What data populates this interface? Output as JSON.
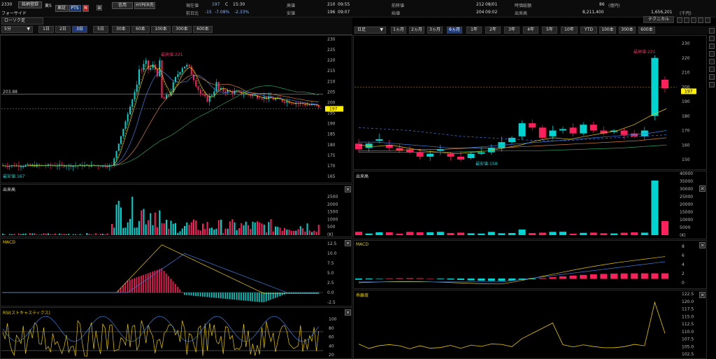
{
  "header": {
    "code": "2330",
    "register_btn": "銘柄登録",
    "market": "東S",
    "company": "フォーサイド",
    "market_tabs": [
      "東証",
      "PTS"
    ],
    "n_badge": "N",
    "margin_btn": "信用",
    "hyper_btn": "HYPER売",
    "stats": {
      "current_label": "現在値",
      "current_value": "197",
      "current_flag": "C",
      "current_time": "15:30",
      "change_label": "前日比",
      "change_value": "-15",
      "change_pct": "-7.08%",
      "change_pct2": "-2.33%",
      "high_label": "高値",
      "high_value": "210",
      "high_time": "09:55",
      "low_label": "安値",
      "low_value": "196",
      "low_time": "09:07",
      "prev_close_label": "前終値",
      "prev_close_value": "212",
      "prev_close_date": "08/01",
      "open_label": "始値",
      "open_value": "204",
      "open_time": "09:02",
      "market_cap_label": "時価総額",
      "market_cap_value": "86",
      "market_cap_unit": "(億円)",
      "volume_label": "出来高",
      "volume_value": "8,211,400",
      "turnover_value": "1,656,201",
      "turnover_unit": "(千円)"
    }
  },
  "left": {
    "chart_type": "ローソク足",
    "interval": "5分",
    "tabs": [
      "1日",
      "2日",
      "3日",
      "5日",
      "30本",
      "60本",
      "100本",
      "300本",
      "600本"
    ],
    "selected_tab": "3日",
    "price_axis": [
      "230",
      "225",
      "220",
      "215",
      "210",
      "205",
      "200",
      "195",
      "190",
      "185",
      "180",
      "175",
      "170",
      "165"
    ],
    "line_label": "203.88",
    "current_price_tag": "197",
    "high_note": "最高値:221",
    "low_note": "最安値:167",
    "volume_label": "出来高",
    "volume_axis": [
      "2500",
      "2000",
      "1500",
      "1000",
      "500",
      "(K)"
    ],
    "macd_label": "MACD",
    "macd_axis": [
      "12.5",
      "10.0",
      "7.5",
      "5.0",
      "2.5",
      "0.0",
      "-2.5"
    ],
    "rsi_label": "RSI(ストキャスティクス)",
    "rsi_axis": [
      "100",
      "80",
      "60",
      "40",
      "20"
    ]
  },
  "right": {
    "interval": "日足",
    "tabs": [
      "1ヵ月",
      "2ヵ月",
      "3ヵ月",
      "6ヵ月",
      "1年",
      "2年",
      "3年",
      "4年",
      "5年",
      "10年",
      "YTD",
      "100本",
      "300本",
      "600本"
    ],
    "selected_tab": "6ヵ月",
    "tech_btn": "テクニカル",
    "price_axis": [
      "230",
      "220",
      "210",
      "200",
      "190",
      "180",
      "170",
      "160",
      "150"
    ],
    "current_price_tag": "197",
    "high_note": "最高値:221",
    "low_note": "最安値:150",
    "volume_label": "出来高",
    "volume_axis": [
      "40000",
      "35000",
      "30000",
      "25000",
      "20000",
      "15000",
      "10000",
      "5000",
      "(K)"
    ],
    "macd_label": "MACD",
    "macd_axis": [
      "8",
      "6",
      "4",
      "2",
      "0"
    ],
    "deviation_label": "乖離度",
    "deviation_axis": [
      "122.5",
      "120.0",
      "117.5",
      "115.0",
      "112.5",
      "110.0",
      "107.5",
      "105.0",
      "102.5"
    ]
  },
  "colors": {
    "up": "#00d4d0",
    "down": "#ff1f5a",
    "yellow": "#e8c800",
    "blue": "#3f7fe0",
    "pricetag": "#ffee00"
  }
}
